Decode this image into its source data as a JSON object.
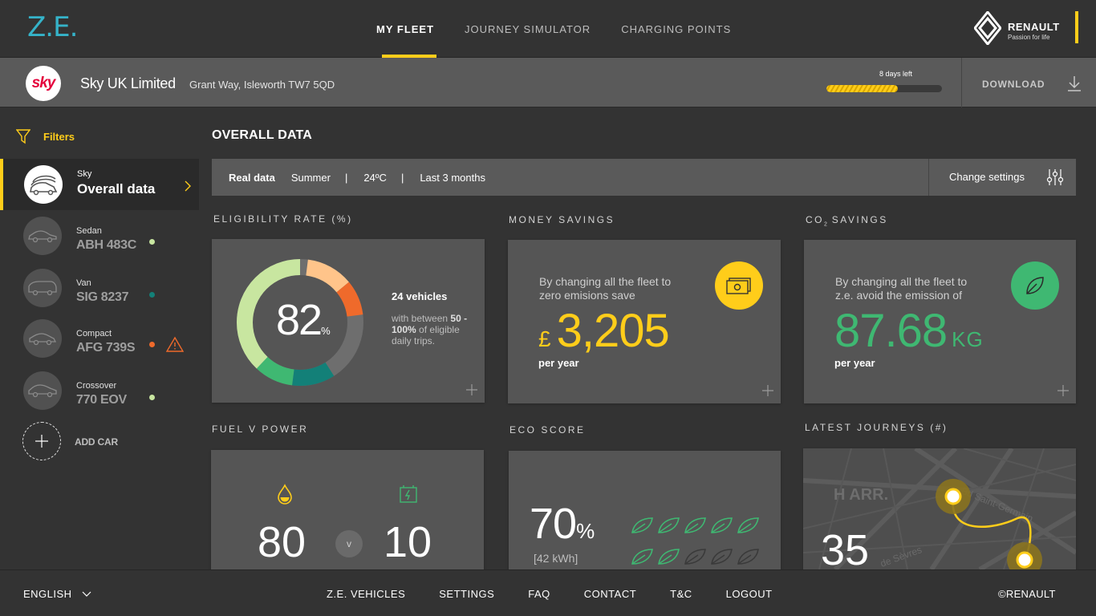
{
  "header": {
    "logo": "Z.E.",
    "nav": [
      "MY FLEET",
      "JOURNEY SIMULATOR",
      "CHARGING POINTS"
    ],
    "active_nav": "MY FLEET",
    "brand": {
      "name": "RENAULT",
      "tagline": "Passion for life"
    },
    "accent_color": "#ffcd1a"
  },
  "company": {
    "logo_text": "sky",
    "name": "Sky UK Limited",
    "address": "Grant Way, Isleworth TW7 5QD",
    "trial_label": "8 days left",
    "trial_progress_pct": 62,
    "download_label": "DOWNLOAD"
  },
  "sidebar": {
    "filters_label": "Filters",
    "overall": {
      "company": "Sky",
      "label": "Overall data"
    },
    "cars": [
      {
        "type": "Sedan",
        "plate": "ABH 483C",
        "status_color": "#c8e6a0",
        "warning": false
      },
      {
        "type": "Van",
        "plate": "SIG 8237",
        "status_color": "#138078",
        "warning": false
      },
      {
        "type": "Compact",
        "plate": "AFG 739S",
        "status_color": "#ef6a2b",
        "warning": true
      },
      {
        "type": "Crossover",
        "plate": "770 EOV",
        "status_color": "#c8e6a0",
        "warning": false
      }
    ],
    "add_car_label": "ADD CAR"
  },
  "main": {
    "title": "OVERALL DATA",
    "settings": {
      "mode": "Real data",
      "season": "Summer",
      "separator": "|",
      "temperature": "24ºC",
      "period": "Last 3 months",
      "change_label": "Change settings"
    },
    "eligibility": {
      "label": "ELIGIBILITY RATE (%)",
      "value": "82",
      "unit": "%",
      "vehicles": "24 vehicles",
      "desc_prefix": "with between",
      "desc_range": "50 - 100%",
      "desc_suffix": "of eligible daily trips."
    },
    "money": {
      "label": "MONEY SAVINGS",
      "text": "By changing all the fleet to zero emisions save",
      "currency": "£",
      "value": "3,205",
      "unit": "per year"
    },
    "co2": {
      "label_prefix": "CO",
      "label_sub": "2",
      "label_suffix": " SAVINGS",
      "text": "By changing all the fleet to z.e. avoid the emission of",
      "value": "87.68",
      "value_unit": "KG",
      "unit": "per year"
    },
    "fuel": {
      "label": "FUEL V POWER",
      "fuel_value": "80",
      "v": "v",
      "power_value": "10"
    },
    "eco": {
      "label": "ECO SCORE",
      "value": "70",
      "unit": "%",
      "kwh": "[42 kWh]",
      "leaves_filled": 7,
      "leaves_total": 10
    },
    "journeys": {
      "label": "LATEST JOURNEYS (#)",
      "value": "35",
      "map_labels": [
        "H ARR.",
        "Bd Saint-Germain",
        "de Sèvres"
      ]
    }
  },
  "footer": {
    "language": "ENGLISH",
    "links": [
      "Z.E. VEHICLES",
      "SETTINGS",
      "FAQ",
      "CONTACT",
      "T&C",
      "LOGOUT"
    ],
    "copyright": "©RENAULT"
  }
}
